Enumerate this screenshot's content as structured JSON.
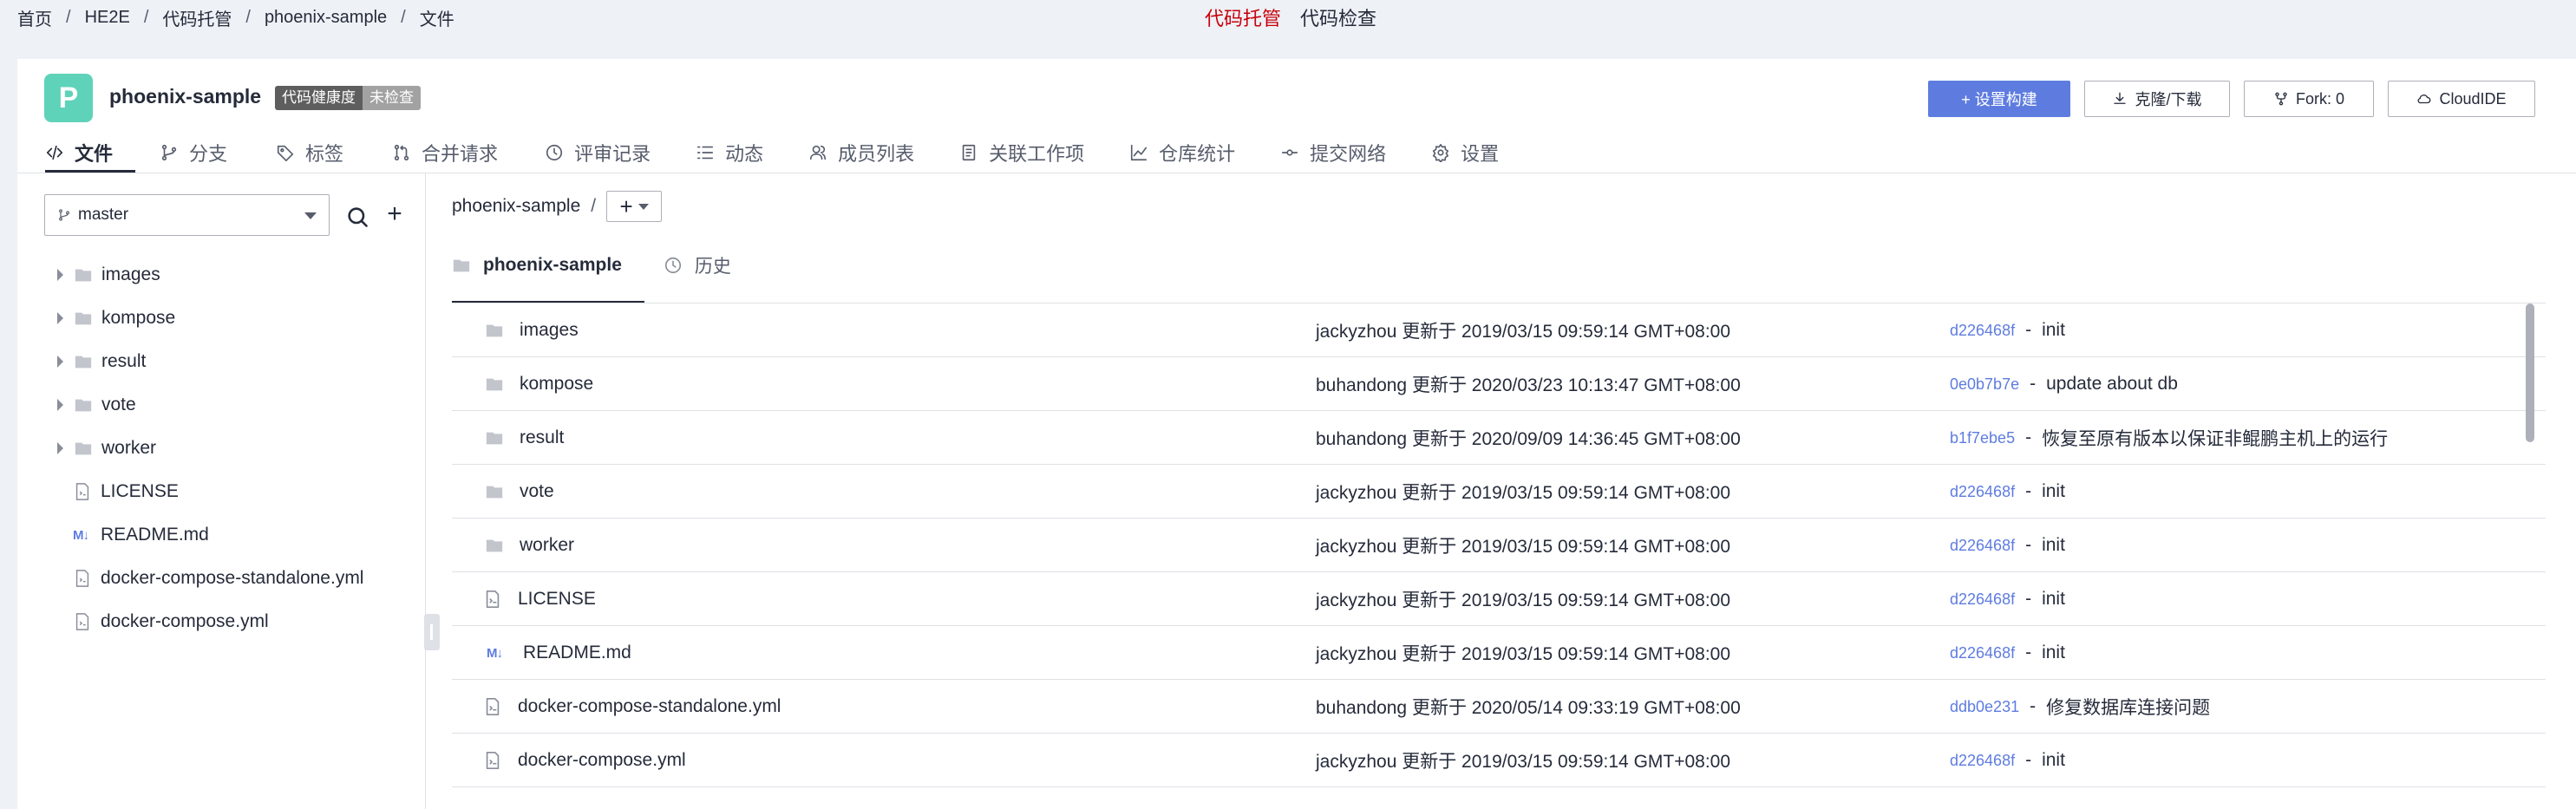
{
  "breadcrumb": [
    "首页",
    "HE2E",
    "代码托管",
    "phoenix-sample",
    "文件"
  ],
  "topnav": [
    {
      "label": "代码托管",
      "active": true
    },
    {
      "label": "代码检查",
      "active": false
    }
  ],
  "repo": {
    "avatar_letter": "P",
    "name": "phoenix-sample",
    "health_label": "代码健康度",
    "health_status": "未检查"
  },
  "actions": {
    "build": "+ 设置构建",
    "clone": "克隆/下载",
    "fork": "Fork: 0",
    "cloudide": "CloudIDE"
  },
  "tabs": [
    {
      "label": "文件",
      "icon": "code-icon",
      "active": true
    },
    {
      "label": "分支",
      "icon": "branch-icon",
      "active": false
    },
    {
      "label": "标签",
      "icon": "tag-icon",
      "active": false
    },
    {
      "label": "合并请求",
      "icon": "merge-request-icon",
      "active": false
    },
    {
      "label": "评审记录",
      "icon": "review-icon",
      "active": false
    },
    {
      "label": "动态",
      "icon": "activity-icon",
      "active": false
    },
    {
      "label": "成员列表",
      "icon": "members-icon",
      "active": false
    },
    {
      "label": "关联工作项",
      "icon": "workitem-icon",
      "active": false
    },
    {
      "label": "仓库统计",
      "icon": "stats-icon",
      "active": false
    },
    {
      "label": "提交网络",
      "icon": "commit-network-icon",
      "active": false
    },
    {
      "label": "设置",
      "icon": "gear-icon",
      "active": false
    }
  ],
  "branch": {
    "selected": "master"
  },
  "tree": [
    {
      "name": "images",
      "type": "folder"
    },
    {
      "name": "kompose",
      "type": "folder"
    },
    {
      "name": "result",
      "type": "folder"
    },
    {
      "name": "vote",
      "type": "folder"
    },
    {
      "name": "worker",
      "type": "folder"
    },
    {
      "name": "LICENSE",
      "type": "file"
    },
    {
      "name": "README.md",
      "type": "markdown"
    },
    {
      "name": "docker-compose-standalone.yml",
      "type": "file"
    },
    {
      "name": "docker-compose.yml",
      "type": "file"
    }
  ],
  "path": {
    "root": "phoenix-sample",
    "sep": "/"
  },
  "subtabs": [
    {
      "label": "phoenix-sample",
      "active": true
    },
    {
      "label": "历史",
      "active": false
    }
  ],
  "files": [
    {
      "name": "images",
      "type": "folder",
      "meta": "jackyzhou 更新于 2019/03/15 09:59:14 GMT+08:00",
      "hash": "d226468f",
      "message": "init"
    },
    {
      "name": "kompose",
      "type": "folder",
      "meta": "buhandong 更新于 2020/03/23 10:13:47 GMT+08:00",
      "hash": "0e0b7b7e",
      "message": "update about db"
    },
    {
      "name": "result",
      "type": "folder",
      "meta": "buhandong 更新于 2020/09/09 14:36:45 GMT+08:00",
      "hash": "b1f7ebe5",
      "message": "恢复至原有版本以保证非鲲鹏主机上的运行"
    },
    {
      "name": "vote",
      "type": "folder",
      "meta": "jackyzhou 更新于 2019/03/15 09:59:14 GMT+08:00",
      "hash": "d226468f",
      "message": "init"
    },
    {
      "name": "worker",
      "type": "folder",
      "meta": "jackyzhou 更新于 2019/03/15 09:59:14 GMT+08:00",
      "hash": "d226468f",
      "message": "init"
    },
    {
      "name": "LICENSE",
      "type": "file",
      "meta": "jackyzhou 更新于 2019/03/15 09:59:14 GMT+08:00",
      "hash": "d226468f",
      "message": "init"
    },
    {
      "name": "README.md",
      "type": "markdown",
      "meta": "jackyzhou 更新于 2019/03/15 09:59:14 GMT+08:00",
      "hash": "d226468f",
      "message": "init"
    },
    {
      "name": "docker-compose-standalone.yml",
      "type": "file",
      "meta": "buhandong 更新于 2020/05/14 09:33:19 GMT+08:00",
      "hash": "ddb0e231",
      "message": "修复数据库连接问题"
    },
    {
      "name": "docker-compose.yml",
      "type": "file",
      "meta": "jackyzhou 更新于 2019/03/15 09:59:14 GMT+08:00",
      "hash": "d226468f",
      "message": "init"
    }
  ],
  "colors": {
    "accent": "#5e7ce0",
    "active_nav": "#c7000b",
    "avatar": "#5fd3b9"
  }
}
